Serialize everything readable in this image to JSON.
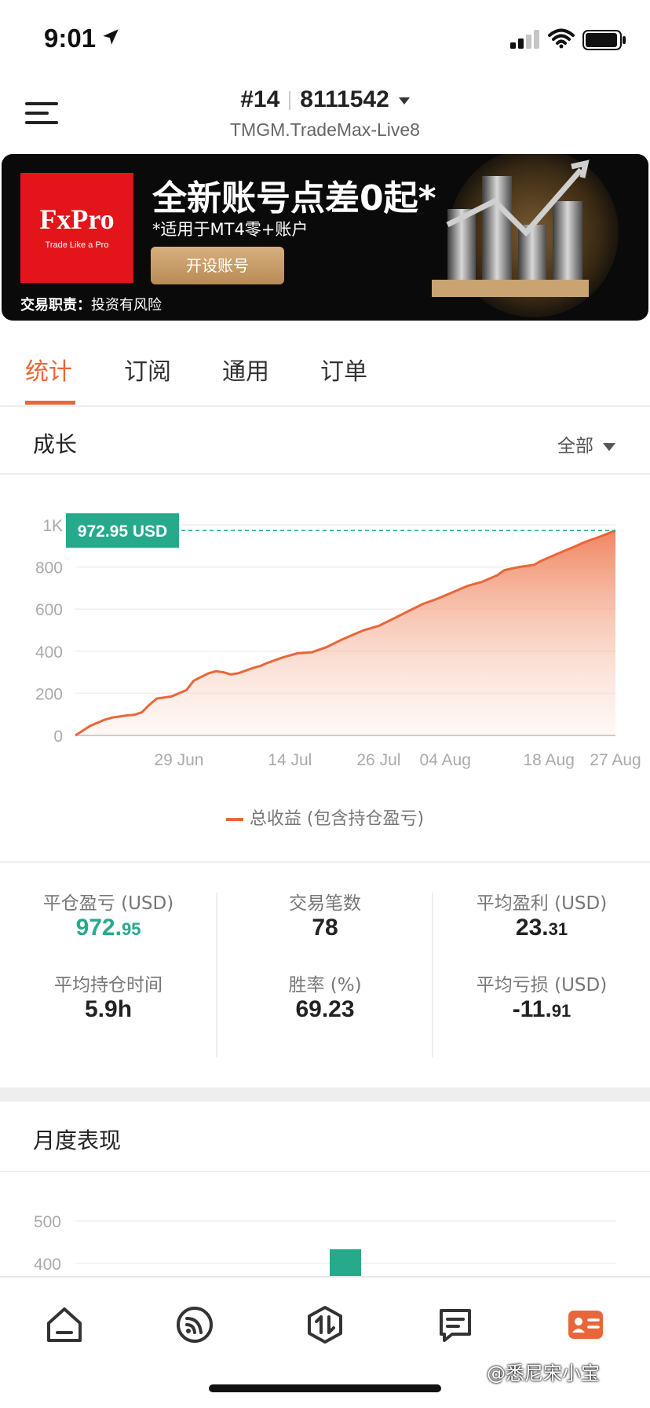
{
  "status_bar": {
    "time": "9:01"
  },
  "header": {
    "account_number": "#14",
    "account_id": "8111542",
    "server": "TMGM.TradeMax-Live8"
  },
  "banner": {
    "brand": "FxPro",
    "brand_tagline": "Trade Like a Pro",
    "headline": "全新账号点差0起*",
    "subline": "*适用于MT4零+账户",
    "button_label": "开设账号",
    "risk_label": "交易职责：",
    "risk_text": "投资有风险"
  },
  "tabs": [
    {
      "label": "统计",
      "active": true
    },
    {
      "label": "订阅",
      "active": false
    },
    {
      "label": "通用",
      "active": false
    },
    {
      "label": "订单",
      "active": false
    }
  ],
  "growth": {
    "title": "成长",
    "range_label": "全部"
  },
  "colors": {
    "accent": "#e8673a",
    "positive": "#27a98c"
  },
  "chart_data": {
    "type": "area",
    "y_ticks": [
      "1K",
      "800",
      "600",
      "400",
      "200",
      "0"
    ],
    "ylim": [
      0,
      1000
    ],
    "x_ticks": [
      "29 Jun",
      "14 Jul",
      "26 Jul",
      "04 Aug",
      "18 Aug",
      "27 Aug"
    ],
    "x_tick_days": [
      14,
      29,
      41,
      50,
      64,
      73
    ],
    "current_value_label": "972.95 USD",
    "current_value": 972.95,
    "series": [
      {
        "name": "总收益 (包含持仓盈亏)",
        "x_days": [
          0,
          2,
          4,
          5,
          7,
          8,
          9,
          10,
          11,
          13,
          15,
          16,
          18,
          19,
          20,
          21,
          22,
          24,
          25,
          26,
          28,
          30,
          32,
          34,
          36,
          37,
          39,
          41,
          43,
          45,
          47,
          49,
          51,
          53,
          55,
          57,
          58,
          60,
          62,
          63,
          65,
          67,
          69,
          71,
          73
        ],
        "values": [
          0,
          45,
          75,
          85,
          95,
          98,
          110,
          145,
          175,
          185,
          215,
          260,
          295,
          305,
          300,
          290,
          295,
          320,
          330,
          345,
          370,
          390,
          395,
          420,
          455,
          470,
          500,
          520,
          555,
          590,
          625,
          650,
          680,
          710,
          730,
          760,
          785,
          800,
          810,
          830,
          860,
          890,
          920,
          945,
          972.95
        ]
      }
    ],
    "grid": true,
    "legend": "bottom-center"
  },
  "stats": [
    {
      "label": "平仓盈亏 (USD)",
      "int": "972.",
      "dec": "95",
      "tone": "positive"
    },
    {
      "label": "交易笔数",
      "int": "78",
      "dec": "",
      "tone": "normal"
    },
    {
      "label": "平均盈利 (USD)",
      "int": "23.",
      "dec": "31",
      "tone": "normal"
    },
    {
      "label": "平均持仓时间",
      "int": "5.9h",
      "dec": "",
      "tone": "normal"
    },
    {
      "label": "胜率 (%)",
      "int": "69.23",
      "dec": "",
      "tone": "normal"
    },
    {
      "label": "平均亏损 (USD)",
      "int": "-11.",
      "dec": "91",
      "tone": "normal"
    }
  ],
  "monthly": {
    "title": "月度表现",
    "chart_data": {
      "type": "bar",
      "y_ticks": [
        "500",
        "400"
      ],
      "visible_bar_value_min": 400
    }
  },
  "nav": [
    {
      "icon": "home-icon",
      "active": false
    },
    {
      "icon": "feed-icon",
      "active": false
    },
    {
      "icon": "trade-icon",
      "active": false
    },
    {
      "icon": "messages-icon",
      "active": false
    },
    {
      "icon": "profile-icon",
      "active": true
    }
  ],
  "watermark": "@悉尼宋小宝"
}
